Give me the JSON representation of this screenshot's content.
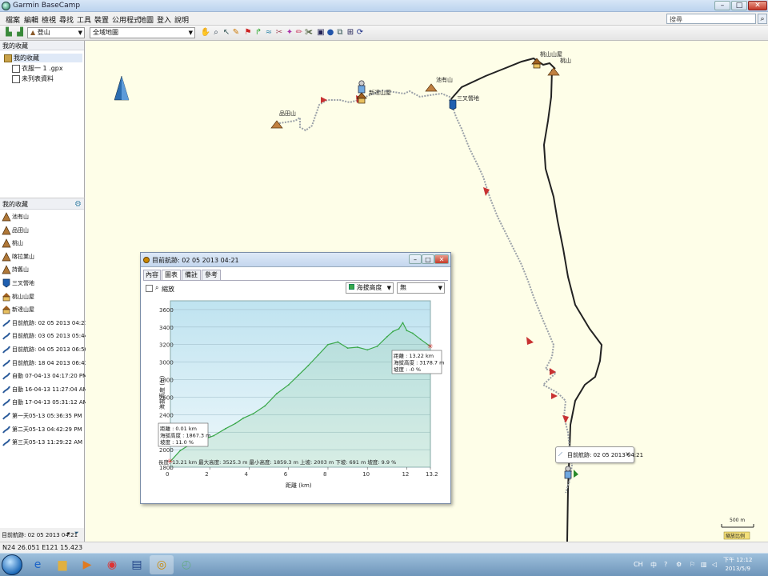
{
  "window": {
    "title": "Garmin BaseCamp",
    "minimize": "–",
    "maximize": "□",
    "close": "✕"
  },
  "menu": [
    "檔案",
    "編輯",
    "檢視",
    "尋找",
    "工具",
    "裝置",
    "公用程式",
    "地圖",
    "登入",
    "說明"
  ],
  "search": {
    "placeholder": "搜尋",
    "icon": "search-icon"
  },
  "toolbar": {
    "profile_combo": "登山",
    "map_combo": "全域地圖"
  },
  "library": {
    "header": "我的收藏",
    "root": "我的收藏",
    "items": [
      "衣服一 1 .gpx",
      "未列表資料"
    ]
  },
  "favorites": {
    "header": "我的收藏",
    "items": [
      {
        "label": "池有山",
        "icon": "summit-icon"
      },
      {
        "label": "品田山",
        "icon": "summit-icon"
      },
      {
        "label": "桃山",
        "icon": "summit-icon"
      },
      {
        "label": "喀拉業山",
        "icon": "summit-icon"
      },
      {
        "label": "詩舊山",
        "icon": "summit-icon"
      },
      {
        "label": "三叉營地",
        "icon": "flag-icon"
      },
      {
        "label": "桃山山屋",
        "icon": "hut-icon"
      },
      {
        "label": "新達山屋",
        "icon": "hut-icon"
      },
      {
        "label": "目前航跡: 02 05 2013 04:21",
        "icon": "track-icon"
      },
      {
        "label": "目前航跡: 03 05 2013 05:44",
        "icon": "track-icon"
      },
      {
        "label": "目前航跡: 04 05 2013 06:50",
        "icon": "track-icon"
      },
      {
        "label": "目前航跡: 18 04 2013 06:43",
        "icon": "track-icon"
      },
      {
        "label": "自動 07-04-13 04:17:20 PM",
        "icon": "track-icon"
      },
      {
        "label": "自動 16-04-13 11:27:04 AM",
        "icon": "track-icon"
      },
      {
        "label": "自動 17-04-13 05:31:12 AM",
        "icon": "track-icon"
      },
      {
        "label": "第一天05-13 05:36:35 PM",
        "icon": "track-icon"
      },
      {
        "label": "第二天05-13 04:42:29 PM",
        "icon": "track-icon"
      },
      {
        "label": "第三天05-13 11:29:22 AM",
        "icon": "track-icon"
      }
    ],
    "footer": "目前航跡: 02 05 2013 04:21"
  },
  "status": {
    "coords": "N24 26.051 E121 15.423"
  },
  "map": {
    "labels": {
      "pintian": "品田山",
      "xinda_hut": "新達山屋",
      "chiyou": "池有山",
      "sancha": "三叉營地",
      "taoshan_hut": "桃山山屋",
      "taoshan": "桃山"
    },
    "callout": "目前航跡: 02 05 2013 04:21",
    "scale": {
      "value": "500 m",
      "note": "縮放比例"
    }
  },
  "profile": {
    "title": "目前航跡: 02 05 2013 04:21",
    "tabs": [
      "內容",
      "圖表",
      "備註",
      "參考"
    ],
    "active_tab": "圖表",
    "zoom_label": "縮放",
    "series_select": "海拔高度",
    "none_select": "無",
    "stats": "長度: 13.21 km   最大高度: 3525.3 m   最小高度: 1859.3 m   上坡: 2003 m   下坡: 691 m   坡度: 9.9 %",
    "left_tip": [
      "距離 : 0.01 km",
      "海拔高度 : 1867.3 m",
      "坡度 : 11.0 %"
    ],
    "right_tip": [
      "距離 : 13.22 km",
      "海拔高度 : 3178.7 m",
      "坡度 : -0 %"
    ]
  },
  "chart_data": {
    "type": "area",
    "xlabel": "距離 (km)",
    "ylabel": "海拔高度 (m)",
    "xlim": [
      0,
      13.2
    ],
    "ylim": [
      1800,
      3700
    ],
    "xticks": [
      0.0,
      2.0,
      4.0,
      6.0,
      8.0,
      10.0,
      12.0,
      13.2
    ],
    "yticks": [
      1800,
      2000,
      2200,
      2400,
      2600,
      2800,
      3000,
      3200,
      3400,
      3600
    ],
    "color": "#3aa84a",
    "series": [
      {
        "x": [
          0,
          0.5,
          1.0,
          1.6,
          2.2,
          2.8,
          3.3,
          3.7,
          4.2,
          4.8,
          5.4,
          6.0,
          6.5,
          7.0,
          7.5,
          8.0,
          8.5,
          9.0,
          9.5,
          10.0,
          10.5,
          11.0,
          11.3,
          11.6,
          11.8,
          12.0,
          12.3,
          12.7,
          13.2
        ],
        "y": [
          1867,
          1990,
          2060,
          2110,
          2160,
          2240,
          2300,
          2360,
          2410,
          2500,
          2640,
          2740,
          2850,
          2960,
          3080,
          3200,
          3230,
          3160,
          3170,
          3140,
          3180,
          3290,
          3350,
          3380,
          3450,
          3360,
          3330,
          3260,
          3179
        ]
      }
    ]
  },
  "taskbar": {
    "apps": [
      "ie-icon",
      "folder-icon",
      "media-icon",
      "chrome-icon",
      "garmin-icon",
      "map-icon",
      "basecamp-icon",
      "history-icon"
    ],
    "lang": "CH",
    "ime": "中",
    "time": "下午 12:12",
    "date": "2013/5/9"
  }
}
